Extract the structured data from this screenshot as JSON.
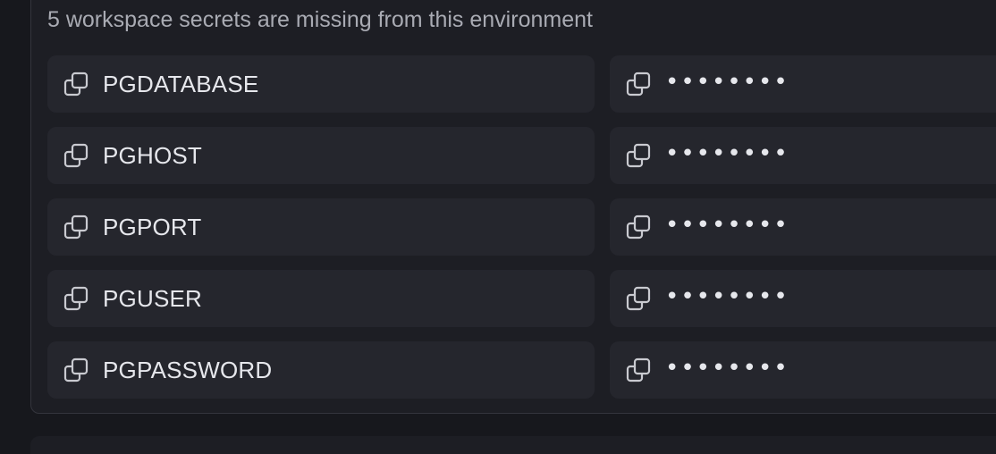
{
  "heading": "5 workspace secrets are missing from this environment",
  "secrets": [
    {
      "key": "PGDATABASE",
      "value": "••••••••"
    },
    {
      "key": "PGHOST",
      "value": "••••••••"
    },
    {
      "key": "PGPORT",
      "value": "••••••••"
    },
    {
      "key": "PGUSER",
      "value": "••••••••"
    },
    {
      "key": "PGPASSWORD",
      "value": "••••••••"
    }
  ],
  "icons": {
    "copy": "copy-icon"
  },
  "colors": {
    "background": "#17181d",
    "panel": "#1d1e24",
    "row": "#25262d",
    "text": "#e6e7ec",
    "muted_text": "#a9abb3",
    "border": "#34353d"
  }
}
